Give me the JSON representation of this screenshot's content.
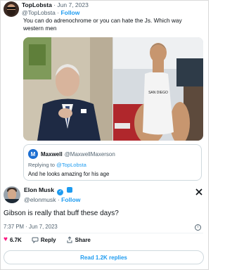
{
  "tweet1": {
    "display_name": "TopLobsta",
    "meta_sep": "·",
    "date": "Jun 7, 2023",
    "handle": "@TopLobsta",
    "follow": "Follow",
    "text": "You can do adrenochrome or you can hate the Js. Which way western men"
  },
  "quoted": {
    "avatar_letter": "M",
    "display_name": "Maxwell",
    "handle": "@MaxwellMaxerson",
    "replying_prefix": "Replying to",
    "replying_handle": "@TopLobsta",
    "text": "And he looks amazing for his age"
  },
  "tweet2": {
    "display_name": "Elon Musk",
    "handle": "@elonmusk",
    "follow": "Follow",
    "text": "Gibson is really that buff these days?",
    "time": "7:37 PM",
    "date": "Jun 7, 2023",
    "likes": "6.7K",
    "reply_label": "Reply",
    "share_label": "Share",
    "read_replies": "Read 1.2K replies"
  },
  "icons": {
    "verified": "verified-badge-icon",
    "x": "x-logo-icon",
    "heart": "heart-icon",
    "reply": "reply-icon",
    "share": "share-icon",
    "info": "info-icon"
  },
  "colors": {
    "accent": "#1d9bf0",
    "like": "#f91880",
    "muted": "#536471",
    "text": "#0f1419"
  }
}
